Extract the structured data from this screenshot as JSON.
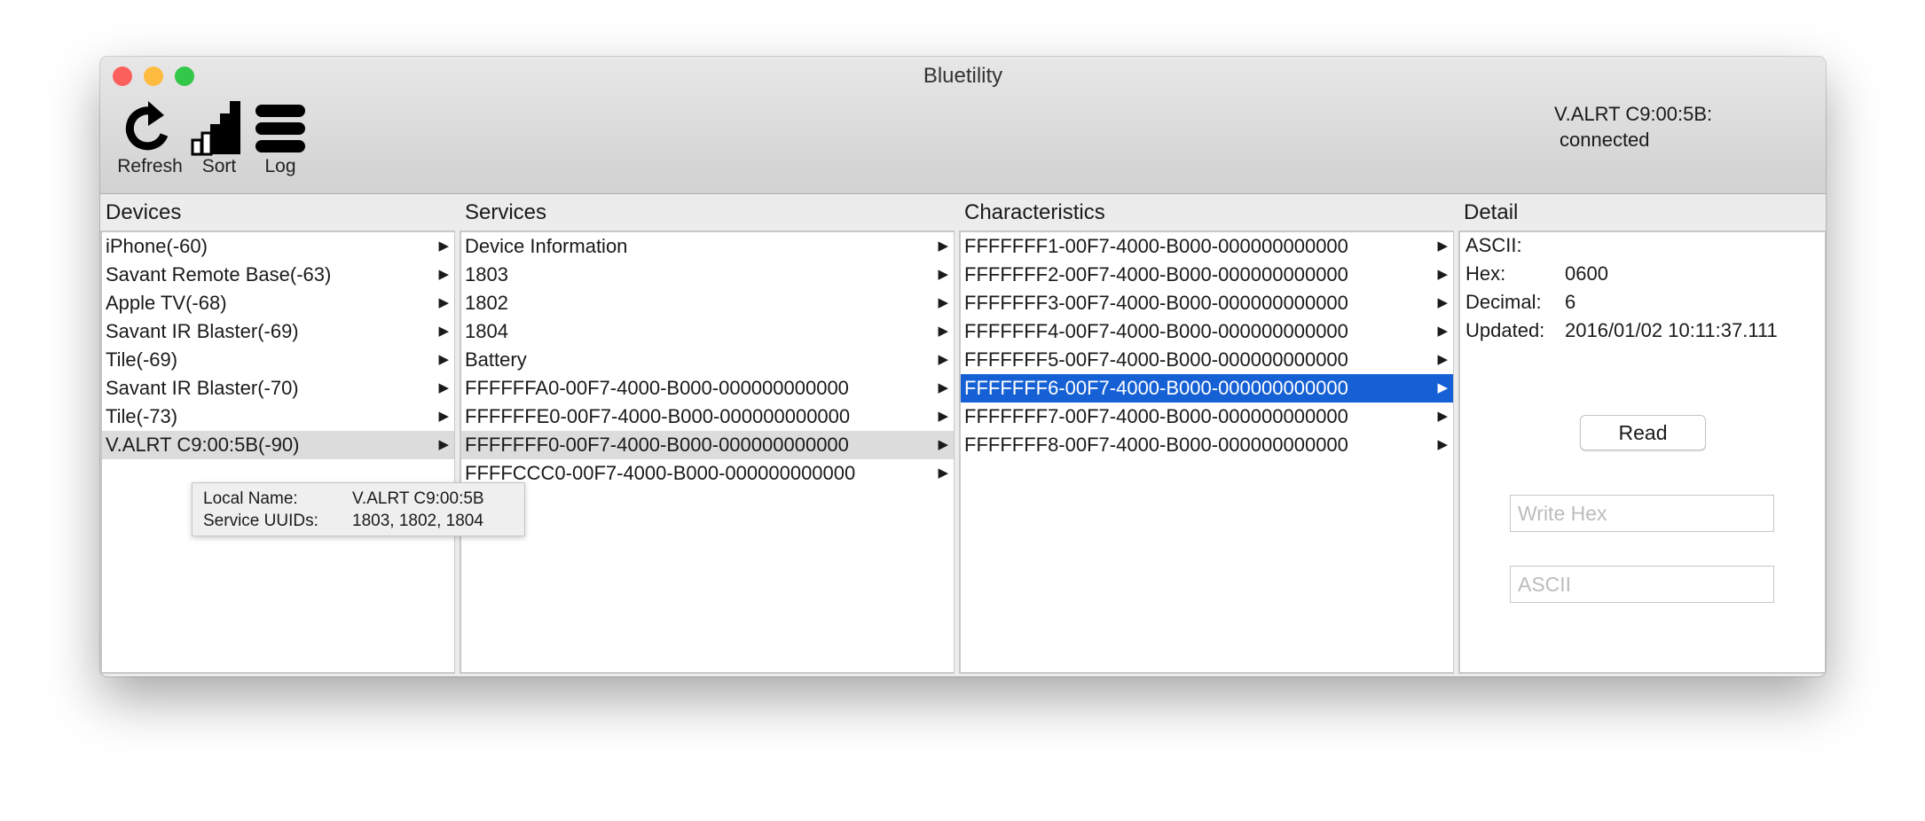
{
  "window": {
    "title": "Bluetility"
  },
  "toolbar": {
    "refresh": "Refresh",
    "sort": "Sort",
    "log": "Log"
  },
  "status": {
    "device": "V.ALRT C9:00:5B:",
    "state": "connected"
  },
  "columns": {
    "devices": "Devices",
    "services": "Services",
    "characteristics": "Characteristics",
    "detail": "Detail"
  },
  "devices": [
    "iPhone(-60)",
    "Savant Remote Base(-63)",
    "Apple TV(-68)",
    "Savant IR Blaster(-69)",
    "Tile(-69)",
    "Savant IR Blaster(-70)",
    "Tile(-73)",
    "V.ALRT C9:00:5B(-90)"
  ],
  "services": [
    "Device Information",
    "1803",
    "1802",
    "1804",
    "Battery",
    "FFFFFFA0-00F7-4000-B000-000000000000",
    "FFFFFFE0-00F7-4000-B000-000000000000",
    "FFFFFFF0-00F7-4000-B000-000000000000",
    "FFFFCCC0-00F7-4000-B000-000000000000"
  ],
  "characteristics": [
    "FFFFFFF1-00F7-4000-B000-000000000000",
    "FFFFFFF2-00F7-4000-B000-000000000000",
    "FFFFFFF3-00F7-4000-B000-000000000000",
    "FFFFFFF4-00F7-4000-B000-000000000000",
    "FFFFFFF5-00F7-4000-B000-000000000000",
    "FFFFFFF6-00F7-4000-B000-000000000000",
    "FFFFFFF7-00F7-4000-B000-000000000000",
    "FFFFFFF8-00F7-4000-B000-000000000000"
  ],
  "selected": {
    "device": 7,
    "service": 7,
    "characteristic": 5
  },
  "tooltip": {
    "local_name_label": "Local Name:",
    "local_name": "V.ALRT C9:00:5B",
    "uuids_label": "Service UUIDs:",
    "uuids": "1803, 1802, 1804"
  },
  "detail": {
    "ascii_label": "ASCII:",
    "ascii": "",
    "hex_label": "Hex:",
    "hex": "0600",
    "decimal_label": "Decimal:",
    "decimal": "6",
    "updated_label": "Updated:",
    "updated": "2016/01/02 10:11:37.111",
    "read": "Read",
    "write_hex_placeholder": "Write Hex",
    "ascii_placeholder": "ASCII"
  },
  "colors": {
    "selection": "#1560d4",
    "close": "#fc605c",
    "minimize": "#fdbc40",
    "zoom": "#34c84a"
  }
}
